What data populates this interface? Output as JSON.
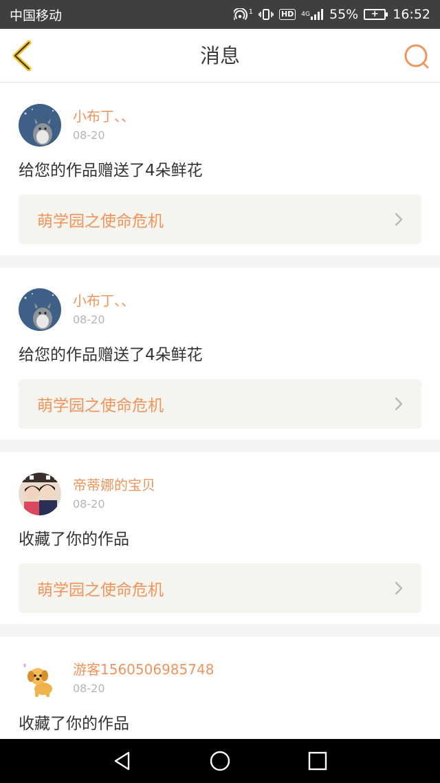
{
  "status_bar": {
    "carrier": "中国移动",
    "battery_percent": "55%",
    "time": "16:52",
    "hotspot_count": "1",
    "hd_label": "HD",
    "network_label": "4G"
  },
  "header": {
    "title": "消息",
    "back_icon": "chevron-left-icon",
    "search_icon": "search-icon"
  },
  "messages": [
    {
      "username": "小布丁、、",
      "date": "08-20",
      "text": "给您的作品赠送了4朵鲜花",
      "work_title": "萌学园之使命危机",
      "avatar": "totoro-avatar"
    },
    {
      "username": "小布丁、、",
      "date": "08-20",
      "text": "给您的作品赠送了4朵鲜花",
      "work_title": "萌学园之使命危机",
      "avatar": "totoro-avatar"
    },
    {
      "username": "帝蒂娜的宝贝",
      "date": "08-20",
      "text": "收藏了你的作品",
      "work_title": "萌学园之使命危机",
      "avatar": "photo-avatar"
    },
    {
      "username": "游客1560506985748",
      "date": "08-20",
      "text": "收藏了你的作品",
      "work_title": "",
      "avatar": "puppy-avatar"
    }
  ],
  "nav_bar": {
    "back_icon": "triangle-back-icon",
    "home_icon": "circle-home-icon",
    "recents_icon": "square-recents-icon"
  },
  "colors": {
    "accent": "#ee955b",
    "status_bar_bg": "#3f3f3f",
    "nav_bar_bg": "#000000",
    "work_box_bg": "#f5f4ef"
  }
}
